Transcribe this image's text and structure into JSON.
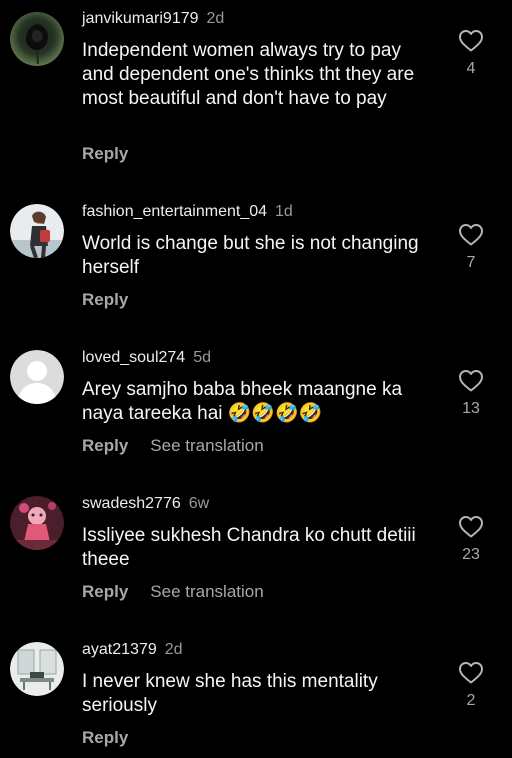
{
  "actions": {
    "reply_label": "Reply",
    "translation_label": "See translation"
  },
  "comments": [
    {
      "username": "janvikumari9179",
      "time": "2d",
      "text": "Independent women always try to pay and dependent one's thinks tht they are most beautiful and don't have to pay",
      "likes": "4",
      "show_translation": false,
      "avatar_icon": "black-rose-avatar"
    },
    {
      "username": "fashion_entertainment_04",
      "time": "1d",
      "text": "World is change but she is not changing herself",
      "likes": "7",
      "show_translation": false,
      "avatar_icon": "woman-photo-avatar"
    },
    {
      "username": "loved_soul274",
      "time": "5d",
      "text": "Arey samjho baba bheek maangne ka naya tareeka hai 🤣🤣🤣🤣",
      "likes": "13",
      "show_translation": true,
      "avatar_icon": "default-user-avatar"
    },
    {
      "username": "swadesh2776",
      "time": "6w",
      "text": "Issliyee sukhesh Chandra ko chutt detiii theee",
      "likes": "23",
      "show_translation": true,
      "avatar_icon": "cartoon-character-avatar"
    },
    {
      "username": "ayat21379",
      "time": "2d",
      "text": "I never knew she has this mentality seriously",
      "likes": "2",
      "show_translation": false,
      "avatar_icon": "room-photo-avatar"
    }
  ],
  "colors": {
    "background": "#000000",
    "text": "#f5f5f5",
    "secondary": "#a8a8a8"
  }
}
